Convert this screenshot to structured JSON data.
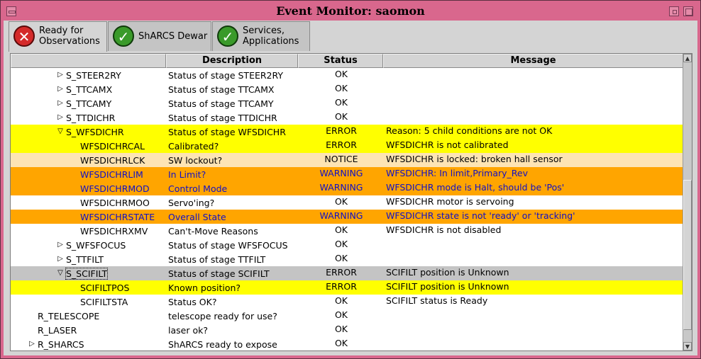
{
  "window": {
    "title": "Event Monitor: saomon"
  },
  "tabs": [
    {
      "label": "Ready for\nObservations",
      "status": "error",
      "active": true
    },
    {
      "label": "ShARCS Dewar",
      "status": "ok",
      "active": false
    },
    {
      "label": "Services,\nApplications",
      "status": "ok",
      "active": false
    }
  ],
  "columns": {
    "name": "",
    "description": "Description",
    "status": "Status",
    "message": "Message"
  },
  "colors": {
    "yellow": "#ffff00",
    "orange": "#ffa500",
    "lightorange": "#fde4b4",
    "gray": "#c4c4c4",
    "link_text": "#1010c8"
  },
  "rows": [
    {
      "name": "S_STEER2RY",
      "description": "Status of stage STEER2RY",
      "status": "OK",
      "message": "",
      "level": 2,
      "expander": "collapsed",
      "highlight": "none"
    },
    {
      "name": "S_TTCAMX",
      "description": "Status of stage TTCAMX",
      "status": "OK",
      "message": "",
      "level": 2,
      "expander": "collapsed",
      "highlight": "none"
    },
    {
      "name": "S_TTCAMY",
      "description": "Status of stage TTCAMY",
      "status": "OK",
      "message": "",
      "level": 2,
      "expander": "collapsed",
      "highlight": "none"
    },
    {
      "name": "S_TTDICHR",
      "description": "Status of stage TTDICHR",
      "status": "OK",
      "message": "",
      "level": 2,
      "expander": "collapsed",
      "highlight": "none"
    },
    {
      "name": "S_WFSDICHR",
      "description": "Status of stage WFSDICHR",
      "status": "ERROR",
      "message": "Reason:  5 child conditions are not OK",
      "level": 2,
      "expander": "expanded",
      "highlight": "yellow"
    },
    {
      "name": "WFSDICHRCAL",
      "description": "Calibrated?",
      "status": "ERROR",
      "message": "WFSDICHR is not calibrated",
      "level": 3,
      "expander": "none",
      "highlight": "yellow"
    },
    {
      "name": "WFSDICHRLCK",
      "description": "SW lockout?",
      "status": "NOTICE",
      "message": "WFSDICHR is locked: broken hall sensor",
      "level": 3,
      "expander": "none",
      "highlight": "lightorange"
    },
    {
      "name": "WFSDICHRLIM",
      "description": "In Limit?",
      "status": "WARNING",
      "message": "WFSDICHR: In limit,Primary_Rev",
      "level": 3,
      "expander": "none",
      "highlight": "orange"
    },
    {
      "name": "WFSDICHRMOD",
      "description": "Control Mode",
      "status": "WARNING",
      "message": "WFSDICHR mode is Halt, should be 'Pos'",
      "level": 3,
      "expander": "none",
      "highlight": "orange"
    },
    {
      "name": "WFSDICHRMOO",
      "description": "Servo'ing?",
      "status": "OK",
      "message": "WFSDICHR motor is servoing",
      "level": 3,
      "expander": "none",
      "highlight": "none"
    },
    {
      "name": "WFSDICHRSTATE",
      "description": "Overall State",
      "status": "WARNING",
      "message": "WFSDICHR state is not 'ready' or 'tracking'",
      "level": 3,
      "expander": "none",
      "highlight": "orange"
    },
    {
      "name": "WFSDICHRXMV",
      "description": "Can't-Move Reasons",
      "status": "OK",
      "message": "WFSDICHR is not disabled",
      "level": 3,
      "expander": "none",
      "highlight": "none"
    },
    {
      "name": "S_WFSFOCUS",
      "description": "Status of stage WFSFOCUS",
      "status": "OK",
      "message": "",
      "level": 2,
      "expander": "collapsed",
      "highlight": "none"
    },
    {
      "name": "S_TTFILT",
      "description": "Status of stage TTFILT",
      "status": "OK",
      "message": "",
      "level": 2,
      "expander": "collapsed",
      "highlight": "none"
    },
    {
      "name": "S_SCIFILT",
      "description": "Status of stage SCIFILT",
      "status": "ERROR",
      "message": "SCIFILT position is Unknown",
      "level": 2,
      "expander": "expanded",
      "highlight": "gray",
      "selected": true
    },
    {
      "name": "SCIFILTPOS",
      "description": "Known position?",
      "status": "ERROR",
      "message": "SCIFILT position is Unknown",
      "level": 3,
      "expander": "none",
      "highlight": "yellow"
    },
    {
      "name": "SCIFILTSTA",
      "description": "Status OK?",
      "status": "OK",
      "message": "SCIFILT status is Ready",
      "level": 3,
      "expander": "none",
      "highlight": "none"
    },
    {
      "name": "R_TELESCOPE",
      "description": "telescope ready for use?",
      "status": "OK",
      "message": "",
      "level": 1,
      "expander": "none",
      "highlight": "none"
    },
    {
      "name": "R_LASER",
      "description": "laser ok?",
      "status": "OK",
      "message": "",
      "level": 1,
      "expander": "none",
      "highlight": "none"
    },
    {
      "name": "R_SHARCS",
      "description": "ShARCS ready to expose",
      "status": "OK",
      "message": "",
      "level": 1,
      "expander": "collapsed",
      "highlight": "none"
    }
  ]
}
